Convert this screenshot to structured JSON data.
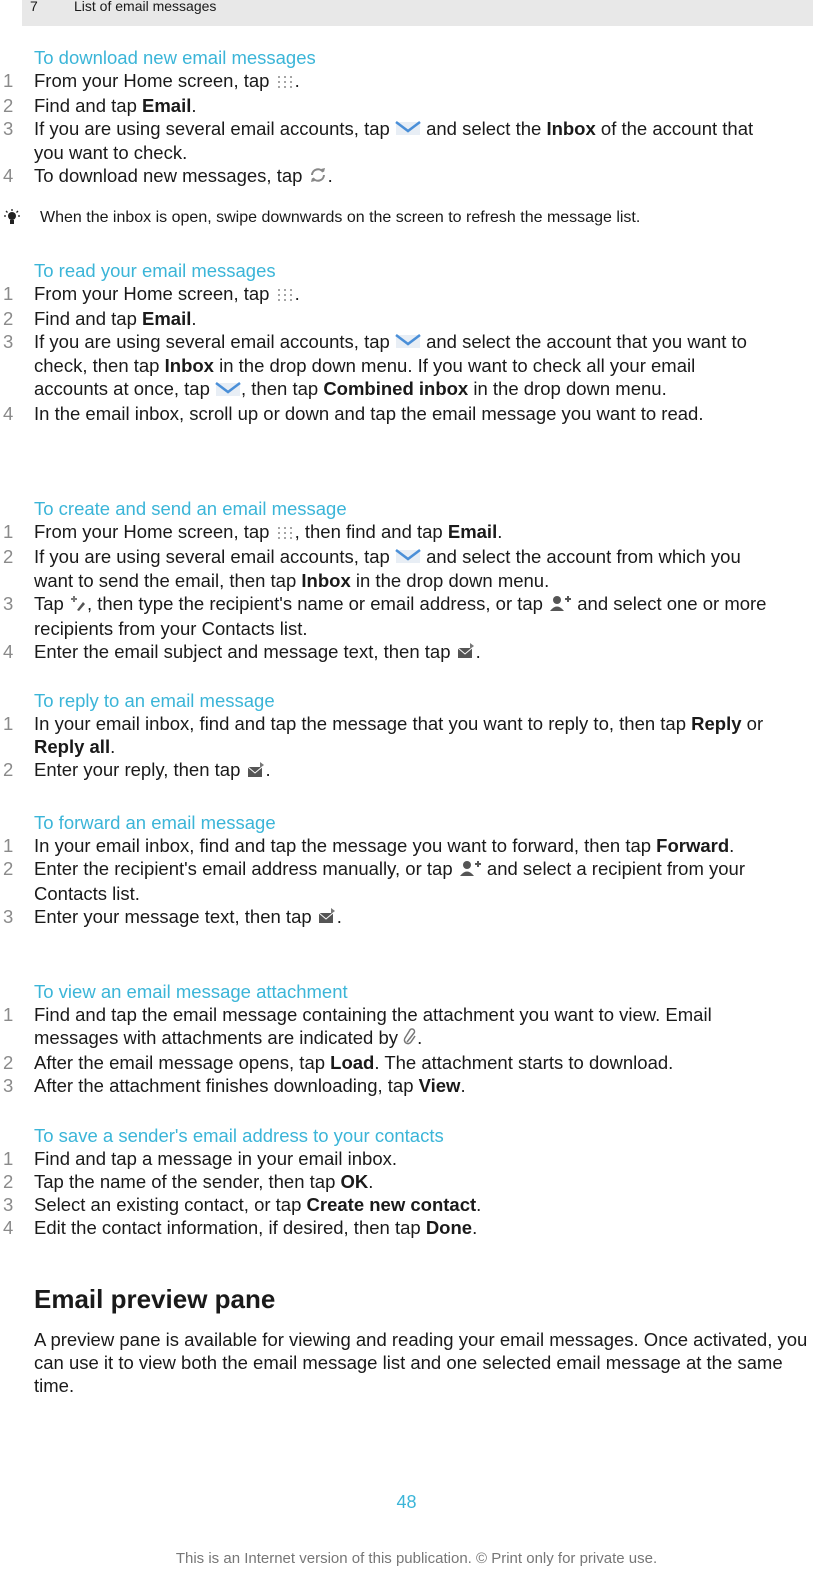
{
  "header": {
    "chapter_number": "7",
    "chapter_title": "List of email messages"
  },
  "sections": [
    {
      "title": "To download new email messages",
      "steps": [
        {
          "n": "1",
          "parts": [
            "From your Home screen, tap ",
            {
              "icon": "apps-grid-icon"
            },
            "."
          ]
        },
        {
          "n": "2",
          "parts": [
            "Find and tap ",
            {
              "b": "Email"
            },
            "."
          ]
        },
        {
          "n": "3",
          "parts": [
            "If you are using several email accounts, tap ",
            {
              "icon": "envelope-icon"
            },
            " and select the ",
            {
              "b": "Inbox"
            },
            " of the account that you want to check."
          ]
        },
        {
          "n": "4",
          "parts": [
            "To download new messages, tap ",
            {
              "icon": "refresh-icon"
            },
            "."
          ]
        }
      ]
    },
    {
      "title": "To read your email messages",
      "steps": [
        {
          "n": "1",
          "parts": [
            "From your Home screen, tap ",
            {
              "icon": "apps-grid-icon"
            },
            "."
          ]
        },
        {
          "n": "2",
          "parts": [
            "Find and tap ",
            {
              "b": "Email"
            },
            "."
          ]
        },
        {
          "n": "3",
          "parts": [
            "If you are using several email accounts, tap ",
            {
              "icon": "envelope-icon"
            },
            " and select the account that you want to check, then tap ",
            {
              "b": "Inbox"
            },
            " in the drop down menu. If you want to check all your email accounts at once, tap ",
            {
              "icon": "envelope-icon"
            },
            ", then tap ",
            {
              "b": "Combined inbox"
            },
            " in the drop down menu."
          ]
        },
        {
          "n": "4",
          "parts": [
            "In the email inbox, scroll up or down and tap the email message you want to read."
          ]
        }
      ]
    },
    {
      "title": "To create and send an email message",
      "steps": [
        {
          "n": "1",
          "parts": [
            "From your Home screen, tap ",
            {
              "icon": "apps-grid-icon"
            },
            ", then find and tap ",
            {
              "b": "Email"
            },
            "."
          ]
        },
        {
          "n": "2",
          "parts": [
            "If you are using several email accounts, tap ",
            {
              "icon": "envelope-icon"
            },
            " and select the account from which you want to send the email, then tap ",
            {
              "b": "Inbox"
            },
            " in the drop down menu."
          ]
        },
        {
          "n": "3",
          "parts": [
            "Tap ",
            {
              "icon": "compose-icon"
            },
            ", then type the recipient's name or email address, or tap ",
            {
              "icon": "add-contact-icon"
            },
            " and select one or more recipients from your Contacts list."
          ]
        },
        {
          "n": "4",
          "parts": [
            "Enter the email subject and message text, then tap ",
            {
              "icon": "send-icon"
            },
            "."
          ]
        }
      ]
    },
    {
      "title": "To reply to an email message",
      "steps": [
        {
          "n": "1",
          "parts": [
            "In your email inbox, find and tap the message that you want to reply to, then tap ",
            {
              "b": "Reply"
            },
            " or ",
            {
              "b": "Reply all"
            },
            "."
          ]
        },
        {
          "n": "2",
          "parts": [
            "Enter your reply, then tap ",
            {
              "icon": "send-icon"
            },
            "."
          ]
        }
      ]
    },
    {
      "title": "To forward an email message",
      "steps": [
        {
          "n": "1",
          "parts": [
            "In your email inbox, find and tap the message you want to forward, then tap ",
            {
              "b": "Forward"
            },
            "."
          ]
        },
        {
          "n": "2",
          "parts": [
            "Enter the recipient's email address manually, or tap ",
            {
              "icon": "add-contact-icon"
            },
            " and select a recipient from your Contacts list."
          ]
        },
        {
          "n": "3",
          "parts": [
            "Enter your message text, then tap ",
            {
              "icon": "send-icon"
            },
            "."
          ]
        }
      ]
    },
    {
      "title": "To view an email message attachment",
      "steps": [
        {
          "n": "1",
          "parts": [
            "Find and tap the email message containing the attachment you want to view. Email messages with attachments are indicated by ",
            {
              "icon": "paperclip-icon"
            },
            "."
          ]
        },
        {
          "n": "2",
          "parts": [
            "After the email message opens, tap ",
            {
              "b": "Load"
            },
            ". The attachment starts to download."
          ]
        },
        {
          "n": "3",
          "parts": [
            "After the attachment finishes downloading, tap ",
            {
              "b": "View"
            },
            "."
          ]
        }
      ]
    },
    {
      "title": "To save a sender's email address to your contacts",
      "steps": [
        {
          "n": "1",
          "parts": [
            "Find and tap a message in your email inbox."
          ]
        },
        {
          "n": "2",
          "parts": [
            "Tap the name of the sender, then tap ",
            {
              "b": "OK"
            },
            "."
          ]
        },
        {
          "n": "3",
          "parts": [
            "Select an existing contact, or tap ",
            {
              "b": "Create new contact"
            },
            "."
          ]
        },
        {
          "n": "4",
          "parts": [
            "Edit the contact information, if desired, then tap ",
            {
              "b": "Done"
            },
            "."
          ]
        }
      ]
    }
  ],
  "tip": "When the inbox is open, swipe downwards on the screen to refresh the message list.",
  "preview": {
    "heading": "Email preview pane",
    "paragraph": "A preview pane is available for viewing and reading your email messages. Once activated, you can use it to view both the email message list and one selected email message at the same time."
  },
  "footer": {
    "page_number": "48",
    "notice": "This is an Internet version of this publication. © Print only for private use."
  },
  "colors": {
    "accent": "#3bb5d8",
    "header_bg": "#e8e8e8"
  }
}
